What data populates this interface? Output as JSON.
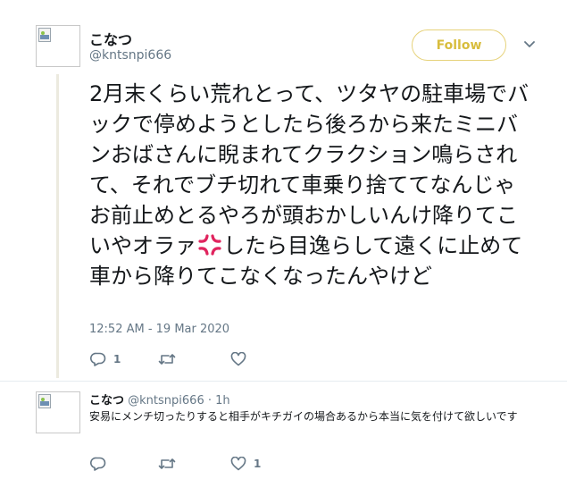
{
  "main_tweet": {
    "display_name": "こなつ",
    "handle": "@kntsnpi666",
    "follow_label": "Follow",
    "text_part1": "2月末くらい荒れとって、ツタヤの駐車場でバックで停めようとしたら後ろから来たミニバンおばさんに睨まれてクラクション鳴らされて、それでブチ切れて車乗り捨ててなんじゃお前止めとるやろが頭おかしいんけ降りてこいやオラァ",
    "text_part2": "したら目逸らして遠くに止めて車から降りてこなくなったんやけど",
    "emoji_icon": "anger-symbol-icon",
    "timestamp": "12:52 AM - 19 Mar 2020",
    "reply_count": "1",
    "retweet_count": "",
    "like_count": ""
  },
  "reply_tweet": {
    "display_name": "こなつ",
    "handle": "@kntsnpi666",
    "time_ago": "· 1h",
    "text": "安易にメンチ切ったりすると相手がキチガイの場合あるから本当に気を付けて欲しいです",
    "reply_count": "",
    "retweet_count": "",
    "like_count": "1"
  },
  "colors": {
    "follow_accent": "#d8bd3d",
    "muted_text": "#657786",
    "thread_line": "#eceadf",
    "anger_red": "#e0245e"
  }
}
